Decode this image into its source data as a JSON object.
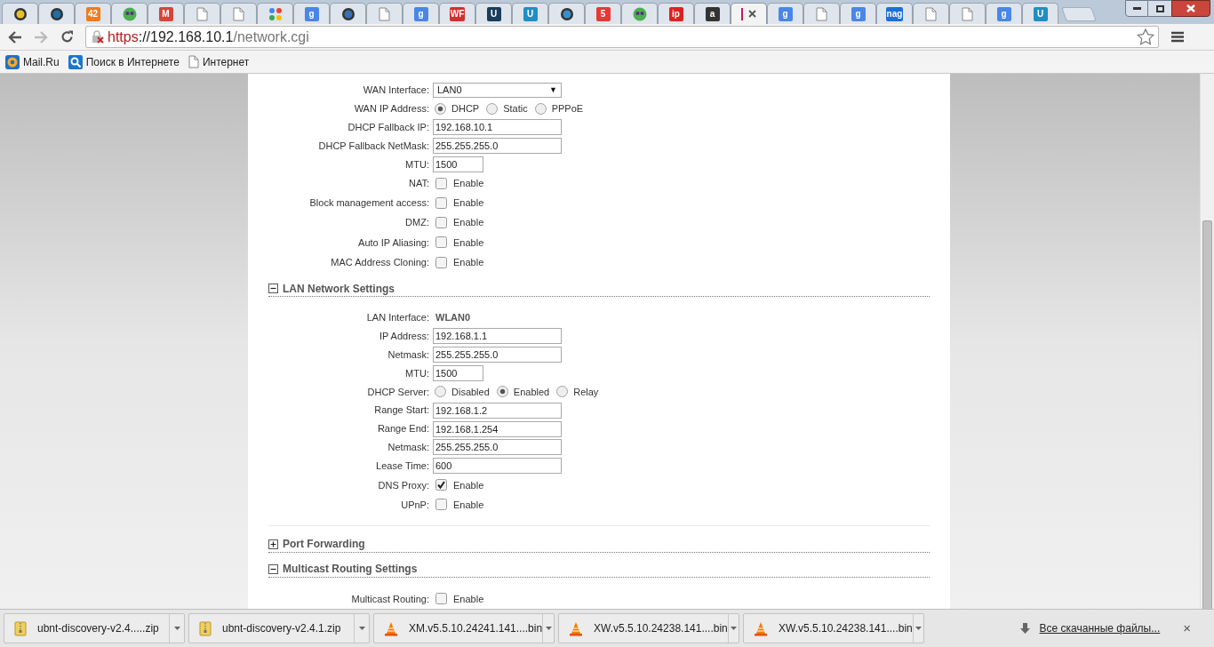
{
  "tabs": [
    {
      "kind": "circle",
      "color": "#e8c12a",
      "selected": false
    },
    {
      "kind": "circle",
      "color": "#1d6fa5",
      "selected": false
    },
    {
      "kind": "letter",
      "glyph": "42",
      "color": "#f07a1c",
      "selected": false
    },
    {
      "kind": "face",
      "color": "#4caf50",
      "selected": false
    },
    {
      "kind": "letter",
      "glyph": "M",
      "color": "#d44638",
      "selected": false
    },
    {
      "kind": "doc",
      "color": "#ffffff",
      "selected": false
    },
    {
      "kind": "doc",
      "color": "#ffffff",
      "selected": false
    },
    {
      "kind": "dots",
      "color": "#4285f4",
      "selected": false
    },
    {
      "kind": "letter",
      "glyph": "g",
      "color": "#4a86e8",
      "selected": false
    },
    {
      "kind": "circle",
      "color": "#3a6fb0",
      "selected": false
    },
    {
      "kind": "doc",
      "color": "#ffffff",
      "selected": false
    },
    {
      "kind": "letter",
      "glyph": "g",
      "color": "#4a86e8",
      "selected": false
    },
    {
      "kind": "letter",
      "glyph": "WF",
      "color": "#d32f2f",
      "selected": false
    },
    {
      "kind": "letter",
      "glyph": "U",
      "color": "#1a3d5c",
      "selected": false
    },
    {
      "kind": "letter",
      "glyph": "U",
      "color": "#1f8fc2",
      "selected": false
    },
    {
      "kind": "circle",
      "color": "#3b8fc9",
      "selected": false
    },
    {
      "kind": "letter",
      "glyph": "5",
      "color": "#e53935",
      "selected": false
    },
    {
      "kind": "face",
      "color": "#4caf50",
      "selected": false
    },
    {
      "kind": "letter",
      "glyph": "ip",
      "color": "#e02020",
      "selected": false
    },
    {
      "kind": "letter",
      "glyph": "a",
      "color": "#333333",
      "selected": false
    },
    {
      "kind": "loading",
      "color": "#c2185b",
      "selected": true
    },
    {
      "kind": "letter",
      "glyph": "g",
      "color": "#4a86e8",
      "selected": false
    },
    {
      "kind": "doc",
      "color": "#ffffff",
      "selected": false
    },
    {
      "kind": "letter",
      "glyph": "g",
      "color": "#4a86e8",
      "selected": false
    },
    {
      "kind": "letter",
      "glyph": "nag",
      "color": "#1e6fd9",
      "selected": false
    },
    {
      "kind": "doc",
      "color": "#ffffff",
      "selected": false
    },
    {
      "kind": "doc",
      "color": "#ffffff",
      "selected": false
    },
    {
      "kind": "letter",
      "glyph": "g",
      "color": "#4a86e8",
      "selected": false
    },
    {
      "kind": "letter",
      "glyph": "U",
      "color": "#1f8fc2",
      "selected": false
    }
  ],
  "address_bar": {
    "scheme": "https",
    "host": "://192.168.10.1",
    "path": "/network.cgi",
    "secure": false
  },
  "bookmarks": [
    {
      "kind": "mail",
      "label": "Mail.Ru"
    },
    {
      "kind": "search",
      "label": "Поиск в Интернете"
    },
    {
      "kind": "page",
      "label": "Интернет"
    }
  ],
  "sections": [
    {
      "rows": [
        {
          "kind": "select",
          "label": "WAN Interface:",
          "value": "LAN0",
          "arrow": "▼"
        },
        {
          "kind": "radio",
          "label": "WAN IP Address:",
          "options": [
            {
              "label": "DHCP",
              "selected": true
            },
            {
              "label": "Static",
              "selected": false
            },
            {
              "label": "PPPoE",
              "selected": false
            }
          ]
        },
        {
          "kind": "text",
          "label": "DHCP Fallback IP:",
          "value": "192.168.10.1"
        },
        {
          "kind": "text",
          "label": "DHCP Fallback NetMask:",
          "value": "255.255.255.0"
        },
        {
          "kind": "number",
          "label": "MTU:",
          "value": "1500"
        },
        {
          "kind": "checkbox",
          "label": "NAT:",
          "option": "Enable",
          "checked": false
        },
        {
          "kind": "checkbox",
          "label": "Block management access:",
          "option": "Enable",
          "checked": false
        },
        {
          "kind": "checkbox",
          "label": "DMZ:",
          "option": "Enable",
          "checked": false
        },
        {
          "kind": "checkbox",
          "label": "Auto IP Aliasing:",
          "option": "Enable",
          "checked": false
        },
        {
          "kind": "checkbox",
          "label": "MAC Address Cloning:",
          "option": "Enable",
          "checked": false
        }
      ]
    },
    {
      "title": "LAN Network Settings",
      "expanded": true,
      "rows": [
        {
          "kind": "static",
          "label": "LAN Interface:",
          "value": "WLAN0"
        },
        {
          "kind": "text",
          "label": "IP Address:",
          "value": "192.168.1.1"
        },
        {
          "kind": "text",
          "label": "Netmask:",
          "value": "255.255.255.0"
        },
        {
          "kind": "number",
          "label": "MTU:",
          "value": "1500"
        },
        {
          "kind": "radio",
          "label": "DHCP Server:",
          "options": [
            {
              "label": "Disabled",
              "selected": false
            },
            {
              "label": "Enabled",
              "selected": true
            },
            {
              "label": "Relay",
              "selected": false
            }
          ]
        },
        {
          "kind": "text",
          "label": "Range Start:",
          "value": "192.168.1.2"
        },
        {
          "kind": "text",
          "label": "Range End:",
          "value": "192.168.1.254"
        },
        {
          "kind": "text",
          "label": "Netmask:",
          "value": "255.255.255.0"
        },
        {
          "kind": "text",
          "label": "Lease Time:",
          "value": "600"
        },
        {
          "kind": "checkbox",
          "label": "DNS Proxy:",
          "option": "Enable",
          "checked": true
        },
        {
          "kind": "checkbox",
          "label": "UPnP:",
          "option": "Enable",
          "checked": false
        }
      ]
    },
    {
      "title": "Port Forwarding",
      "expanded": false
    },
    {
      "title": "Multicast Routing Settings",
      "expanded": true,
      "rows": [
        {
          "kind": "checkbox",
          "label": "Multicast Routing:",
          "option": "Enable",
          "checked": false
        }
      ]
    }
  ],
  "downloads": [
    {
      "kind": "zip",
      "name": "ubnt-discovery-v2.4.....zip"
    },
    {
      "kind": "zip",
      "name": "ubnt-discovery-v2.4.1.zip"
    },
    {
      "kind": "vlc",
      "name": "XM.v5.5.10.24241.141....bin"
    },
    {
      "kind": "vlc",
      "name": "XW.v5.5.10.24238.141....bin"
    },
    {
      "kind": "vlc",
      "name": "XW.v5.5.10.24238.141....bin"
    }
  ],
  "all_downloads_link": "Все скачанные файлы...",
  "close_glyph": "×"
}
